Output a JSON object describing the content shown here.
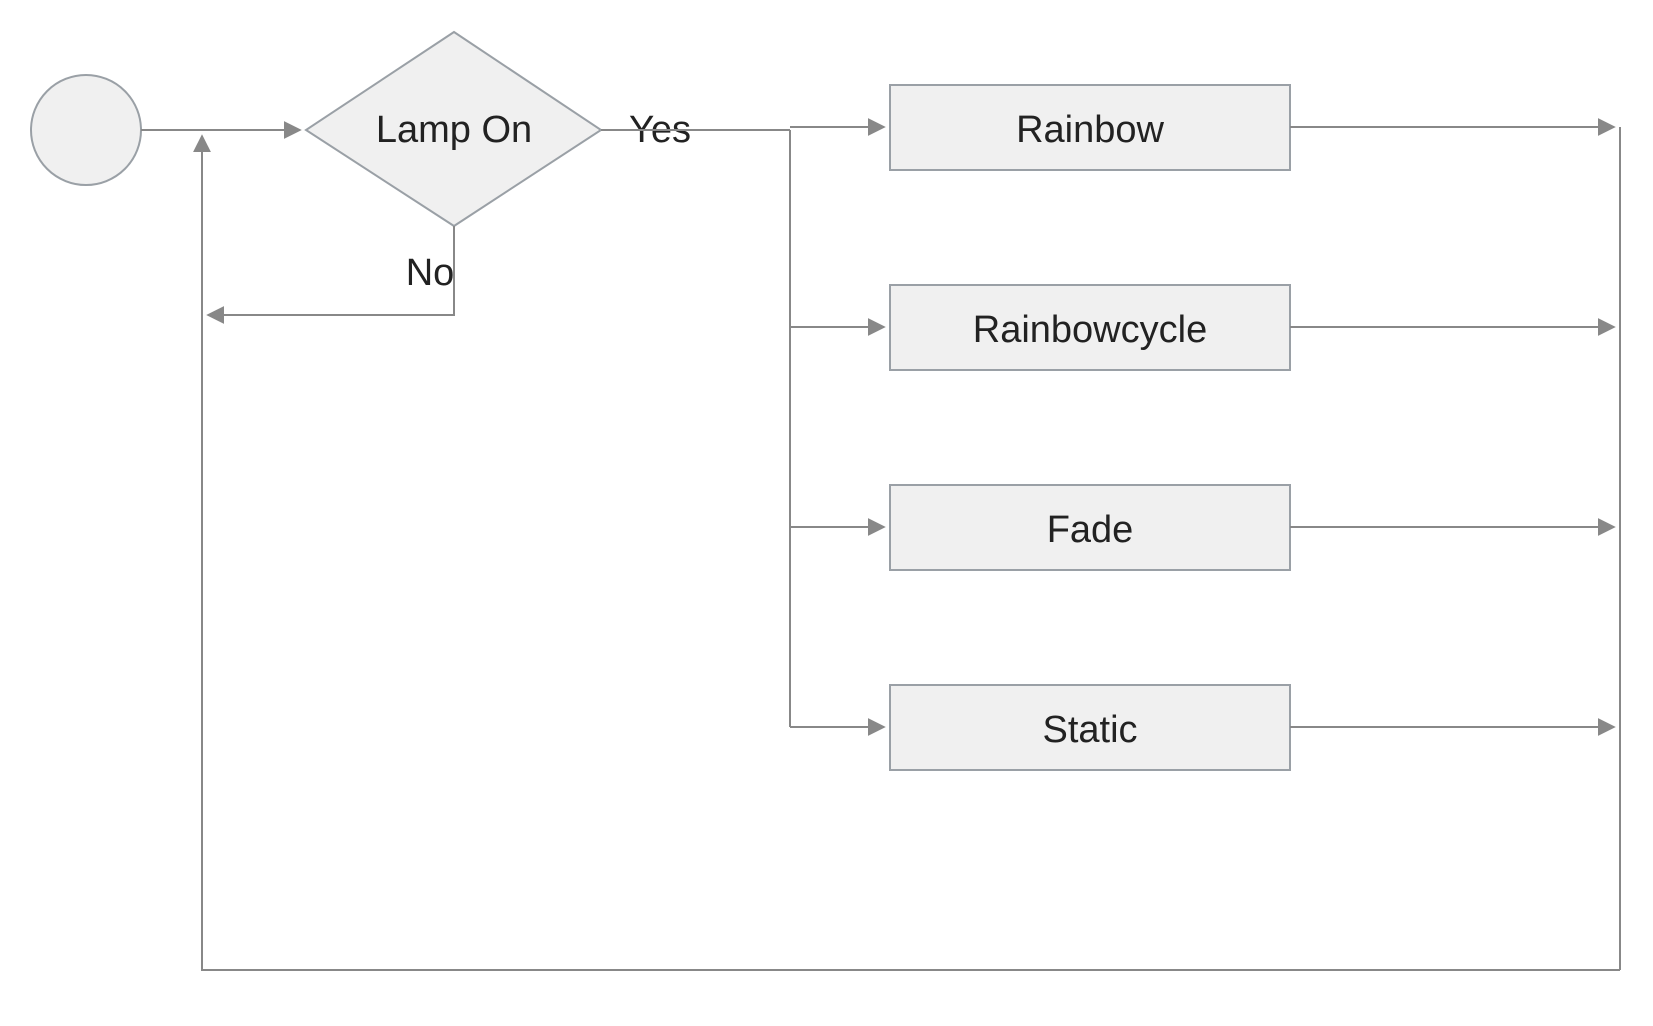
{
  "decision": {
    "label": "Lamp On",
    "yes": "Yes",
    "no": "No"
  },
  "processes": [
    {
      "label": "Rainbow"
    },
    {
      "label": "Rainbowcycle"
    },
    {
      "label": "Fade"
    },
    {
      "label": "Static"
    }
  ]
}
